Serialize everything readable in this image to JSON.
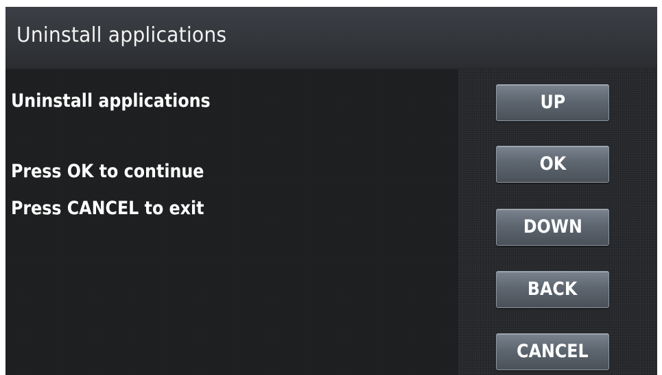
{
  "header": {
    "title": "Uninstall applications"
  },
  "content": {
    "heading": "Uninstall applications",
    "instruction_ok": "Press OK to continue",
    "instruction_cancel": "Press CANCEL to exit"
  },
  "buttons": {
    "up": "UP",
    "ok": "OK",
    "down": "DOWN",
    "back": "BACK",
    "cancel": "CANCEL"
  },
  "colors": {
    "background": "#2a2c30",
    "content_panel": "#1c1e1f",
    "button_face": "#5e6670",
    "text": "#ffffff"
  }
}
